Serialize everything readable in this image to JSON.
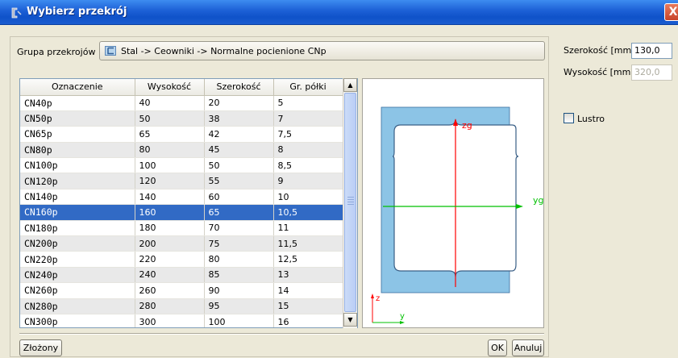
{
  "window": {
    "title": "Wybierz przekrój",
    "close_glyph": "X"
  },
  "group": {
    "label": "Grupa przekrojów",
    "value": "Stal -> Ceowniki -> Normalne pocienione CNp"
  },
  "table": {
    "headers": [
      "Oznaczenie",
      "Wysokość",
      "Szerokość",
      "Gr. półki"
    ],
    "rows": [
      [
        "CN40p",
        "40",
        "20",
        "5"
      ],
      [
        "CN50p",
        "50",
        "38",
        "7"
      ],
      [
        "CN65p",
        "65",
        "42",
        "7,5"
      ],
      [
        "CN80p",
        "80",
        "45",
        "8"
      ],
      [
        "CN100p",
        "100",
        "50",
        "8,5"
      ],
      [
        "CN120p",
        "120",
        "55",
        "9"
      ],
      [
        "CN140p",
        "140",
        "60",
        "10"
      ],
      [
        "CN160p",
        "160",
        "65",
        "10,5"
      ],
      [
        "CN180p",
        "180",
        "70",
        "11"
      ],
      [
        "CN200p",
        "200",
        "75",
        "11,5"
      ],
      [
        "CN220p",
        "220",
        "80",
        "12,5"
      ],
      [
        "CN240p",
        "240",
        "85",
        "13"
      ],
      [
        "CN260p",
        "260",
        "90",
        "14"
      ],
      [
        "CN280p",
        "280",
        "95",
        "15"
      ],
      [
        "CN300p",
        "300",
        "100",
        "16"
      ]
    ],
    "selected_index": 7
  },
  "preview": {
    "axis_zg": "zg",
    "axis_yg": "yg",
    "axis_z": "z",
    "axis_y": "y"
  },
  "side": {
    "width_label": "Szerokość [mm]",
    "width_value": "130,0",
    "height_label": "Wysokość [mm]",
    "height_value": "320,0",
    "mirror_label": "Lustro"
  },
  "buttons": {
    "compound": "Złożony",
    "ok": "OK",
    "cancel": "Anuluj"
  },
  "colors": {
    "selection": "#316ac5",
    "section_fill": "#8cc4e6",
    "axis_red": "#ff0000",
    "axis_green": "#00c000"
  },
  "icons": {
    "title": "section-app-icon",
    "group": "channel-section-icon",
    "close": "close-icon"
  }
}
